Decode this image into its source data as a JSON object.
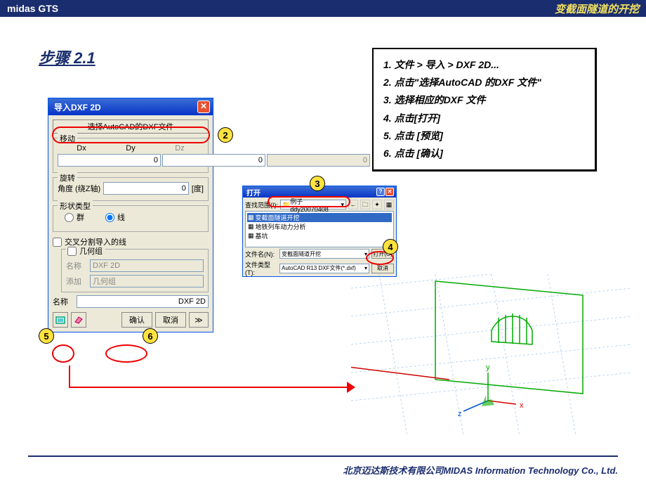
{
  "header": {
    "left": "midas GTS",
    "right": "变截面隧道的开挖"
  },
  "step_title": "步骤 2.1",
  "instructions": [
    "1. 文件 > 导入 > DXF 2D...",
    "2. 点击\"选择AutoCAD 的DXF 文件\"",
    "3. 选择相应的DXF 文件",
    "4. 点击[打开]",
    "5. 点击 [预览]",
    "6. 点击 [确认]"
  ],
  "dlg1": {
    "title": "导入DXF 2D",
    "select_btn": "选择AutoCAD的DXF文件",
    "move": {
      "label": "移动",
      "dx": "Dx",
      "dy": "Dy",
      "dz": "Dz",
      "vdx": "0",
      "vdy": "0",
      "vdz": "0"
    },
    "rotate": {
      "label": "旋转",
      "angle_label": "角度 (绕Z轴)",
      "value": "0",
      "unit": "[度]"
    },
    "shape": {
      "label": "形状类型",
      "group": "群",
      "line": "线"
    },
    "cross": "交叉分割导入的线",
    "geom": {
      "label": "几何组",
      "name_lbl": "名称",
      "name_val": "DXF 2D",
      "add_lbl": "添加",
      "add_val": "几何组"
    },
    "name2_lbl": "名称",
    "name2_val": "DXF 2D",
    "ok": "确认",
    "cancel": "取消"
  },
  "dlg2": {
    "title": "打开",
    "lookin_lbl": "查找范围(I):",
    "lookin_val": "例子ddy20070408",
    "items": [
      "变截面隧道开挖",
      "地铁列车动力分析",
      "基坑"
    ],
    "filename_lbl": "文件名(N):",
    "filename_val": "变截面隧道开挖",
    "filetype_lbl": "文件类型(T):",
    "filetype_val": "AutoCAD R13 DXF文件(*.dxf)",
    "open_btn": "打开(O)",
    "cancel_btn": "取消"
  },
  "footer": "北京迈达斯技术有限公司MIDAS Information  Technology Co.,  Ltd.",
  "callouts": {
    "c2": "2",
    "c3": "3",
    "c4": "4",
    "c5": "5",
    "c6": "6"
  },
  "axes": {
    "x": "x",
    "y": "y",
    "z": "z"
  }
}
